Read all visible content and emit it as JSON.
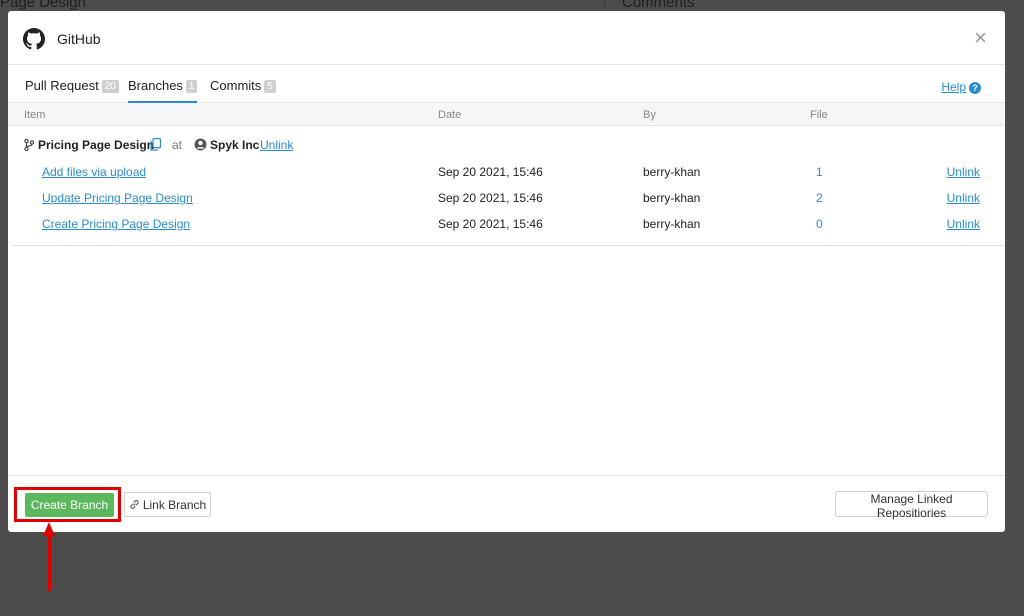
{
  "background": {
    "page_title": "Page Design",
    "comments_title": "Comments"
  },
  "modal": {
    "title": "GitHub",
    "close_symbol": "×"
  },
  "tabs": [
    {
      "label": "Pull Request",
      "count": "20",
      "active": false
    },
    {
      "label": "Branches",
      "count": "1",
      "active": true
    },
    {
      "label": "Commits",
      "count": "5",
      "active": false
    }
  ],
  "help_label": "Help",
  "columns": {
    "item": "Item",
    "date": "Date",
    "by": "By",
    "file": "File"
  },
  "branch": {
    "name": "Pricing Page Design",
    "at": "at",
    "org": "Spyk Inc",
    "unlink": "Unlink"
  },
  "commits": [
    {
      "item": "Add files via upload",
      "date": "Sep 20 2021, 15:46",
      "by": "berry-khan",
      "file": "1",
      "unlink": "Unlink"
    },
    {
      "item": "Update Pricing Page Design",
      "date": "Sep 20 2021, 15:46",
      "by": "berry-khan",
      "file": "2",
      "unlink": "Unlink"
    },
    {
      "item": "Create Pricing Page Design",
      "date": "Sep 20 2021, 15:46",
      "by": "berry-khan",
      "file": "0",
      "unlink": "Unlink"
    }
  ],
  "footer": {
    "create_branch": "Create Branch",
    "link_branch": "Link Branch",
    "manage_repos": "Manage Linked Repositiories"
  },
  "colors": {
    "accent": "#2a8ccf",
    "primary_button": "#5cb85c",
    "annotation": "#e00000"
  }
}
